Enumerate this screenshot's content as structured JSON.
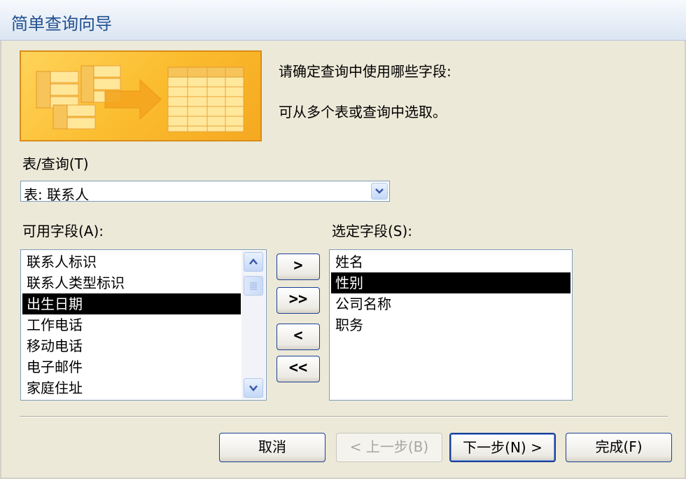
{
  "window": {
    "title": "简单查询向导"
  },
  "instructions": {
    "line1": "请确定查询中使用哪些字段:",
    "line2": "可从多个表或查询中选取。"
  },
  "table_query": {
    "label": "表/查询(T)",
    "value": "表: 联系人"
  },
  "available_fields": {
    "label": "可用字段(A):",
    "items": [
      "联系人标识",
      "联系人类型标识",
      "出生日期",
      "工作电话",
      "移动电话",
      "电子邮件",
      "家庭住址"
    ],
    "selected_index": 2
  },
  "selected_fields": {
    "label": "选定字段(S):",
    "items": [
      "姓名",
      "性别",
      "公司名称",
      "职务"
    ],
    "selected_index": 1
  },
  "move_buttons": {
    "add_one": ">",
    "add_all": ">>",
    "remove_one": "<",
    "remove_all": "<<"
  },
  "footer": {
    "cancel": "取消",
    "back": "< 上一步(B)",
    "next": "下一步(N) >",
    "finish": "完成(F)"
  },
  "colors": {
    "art_border": "#d98c1a",
    "art_fill": "#fbbd2f",
    "selection": "#000000",
    "title_text": "#1f4f8f"
  },
  "icons": {
    "dropdown": "chevron-down-icon",
    "scroll_up": "chevron-up-icon",
    "scroll_down": "chevron-down-icon"
  }
}
